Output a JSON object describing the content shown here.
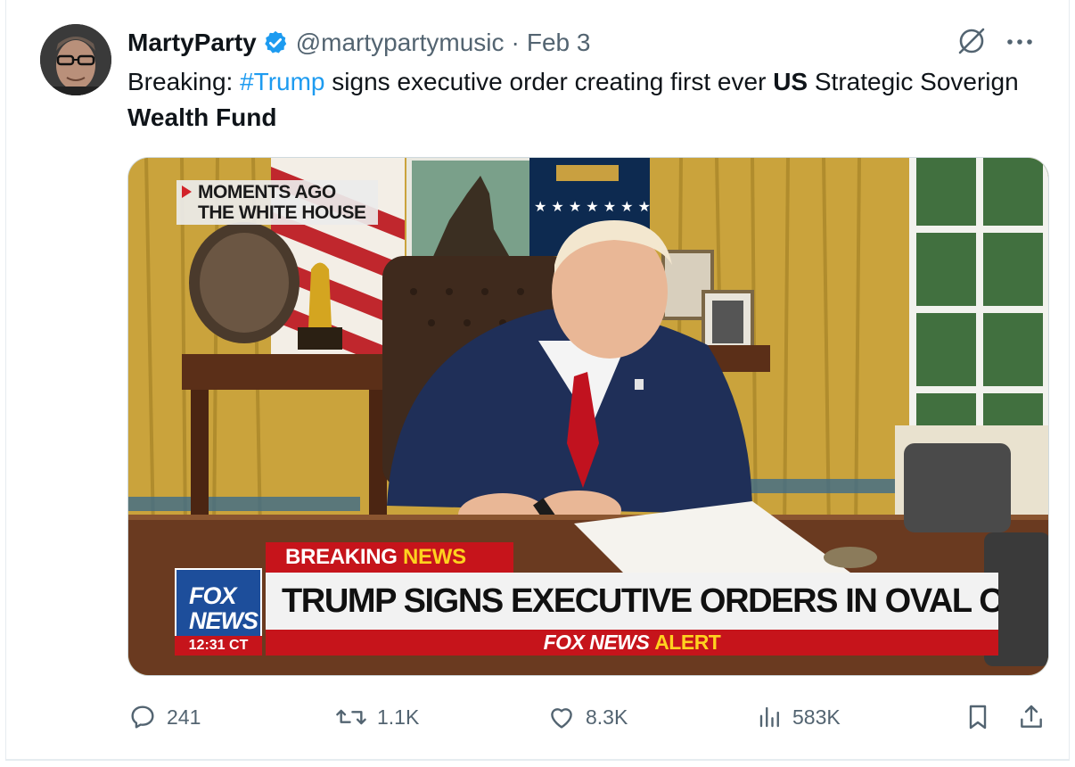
{
  "tweet": {
    "display_name": "MartyParty",
    "handle": "@martypartymusic",
    "separator": "·",
    "date": "Feb 3",
    "text": {
      "prefix": "Breaking: ",
      "hashtag": "#Trump",
      "middle": " signs executive order creating first ever ",
      "bold1": "US",
      "middle2": " Strategic Soverign ",
      "bold2": "Wealth Fund"
    }
  },
  "media": {
    "moments_line1": "MOMENTS AGO",
    "moments_line2": "THE WHITE HOUSE",
    "breaking_word": "BREAKING",
    "breaking_news_word": "NEWS",
    "logo_fox": "FOX",
    "logo_news": "NEWS",
    "logo_time": "12:31 CT",
    "headline": "TRUMP SIGNS EXECUTIVE ORDERS IN OVAL OFFICE",
    "alert_brand": "FOX NEWS",
    "alert_word": "ALERT"
  },
  "actions": {
    "replies": "241",
    "reposts": "1.1K",
    "likes": "8.3K",
    "views": "583K"
  },
  "colors": {
    "accent": "#1d9bf0",
    "muted": "#536471",
    "fox_red": "#c6141b",
    "fox_blue": "#1d4e9b",
    "fox_yellow": "#ffd21f"
  },
  "icons": {
    "verified": "verified-badge-icon",
    "grok": "grok-icon",
    "more": "more-icon",
    "reply": "reply-icon",
    "repost": "repost-icon",
    "like": "heart-icon",
    "views": "views-icon",
    "bookmark": "bookmark-icon",
    "share": "share-icon"
  }
}
